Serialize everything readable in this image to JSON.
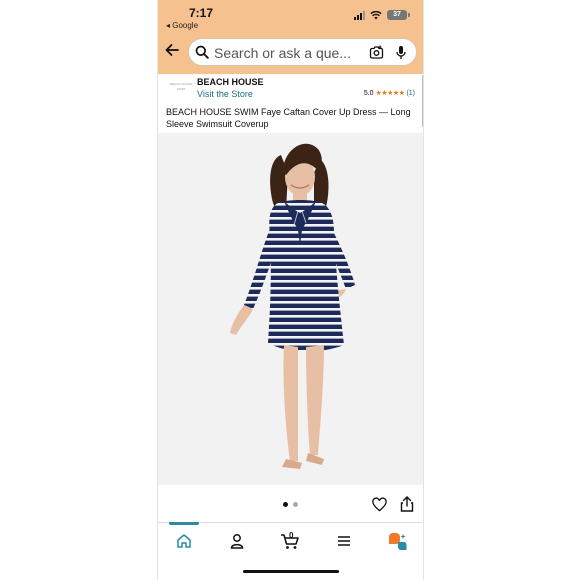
{
  "status_bar": {
    "time": "7:17",
    "back_app": "◂ Google",
    "battery": "37"
  },
  "search": {
    "placeholder": "Search or ask a que..."
  },
  "store": {
    "name": "BEACH HOUSE",
    "link": "Visit the Store",
    "logo_text": "BEACH HOUSE SWIM",
    "rating_value": "5.0",
    "stars": "★★★★★",
    "rating_count": "(1)"
  },
  "product": {
    "title": "BEACH HOUSE SWIM Faye Caftan Cover Up Dress — Long Sleeve Swimsuit Coverup"
  },
  "carousel": {
    "total": 2,
    "active": 1
  },
  "cart": {
    "count": "0"
  },
  "colors": {
    "accent": "#f5c28f",
    "link": "#1b6f86",
    "star": "#e77b1d",
    "dress_navy": "#1e2a5a"
  },
  "icons": [
    "back-arrow-icon",
    "search-icon",
    "camera-icon",
    "mic-icon",
    "heart-icon",
    "share-icon",
    "home-icon",
    "account-icon",
    "cart-icon",
    "menu-icon",
    "ai-assistant-icon"
  ]
}
